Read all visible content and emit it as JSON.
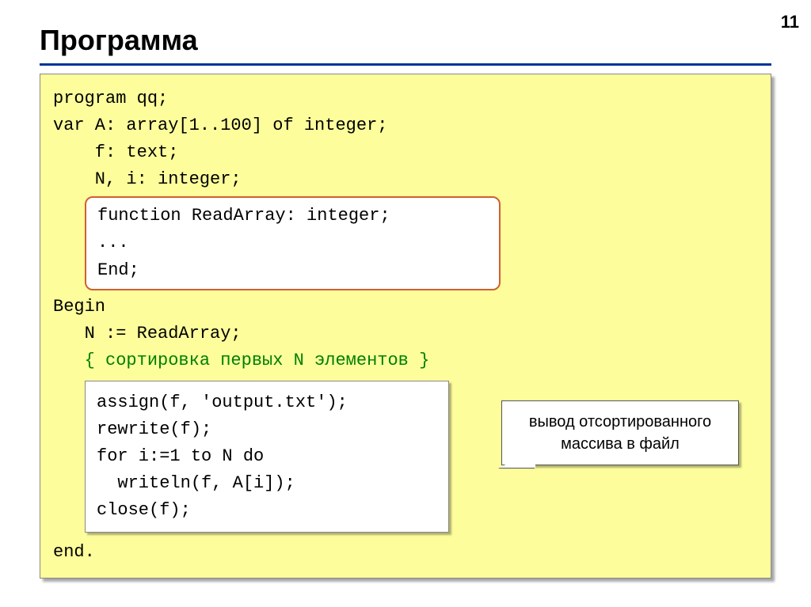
{
  "page_number": "11",
  "title": "Программа",
  "code": {
    "line1": "program qq;",
    "line2": "var A: array[1..100] of integer;",
    "line3": "    f: text;",
    "line4": "    N, i: integer;",
    "func_box": {
      "line1": "function ReadArray: integer;",
      "line2": "...",
      "line3": "End;"
    },
    "line5": "Begin",
    "line6": "   N := ReadArray;",
    "line7_comment": "   { сортировка первых N элементов }",
    "write_box": {
      "line1": "assign(f, 'output.txt');",
      "line2": "rewrite(f);",
      "line3": "for i:=1 to N do",
      "line4": "  writeln(f, A[i]);",
      "line5": "close(f);"
    },
    "line8": "end."
  },
  "callout": "вывод отсортированного массива в файл"
}
